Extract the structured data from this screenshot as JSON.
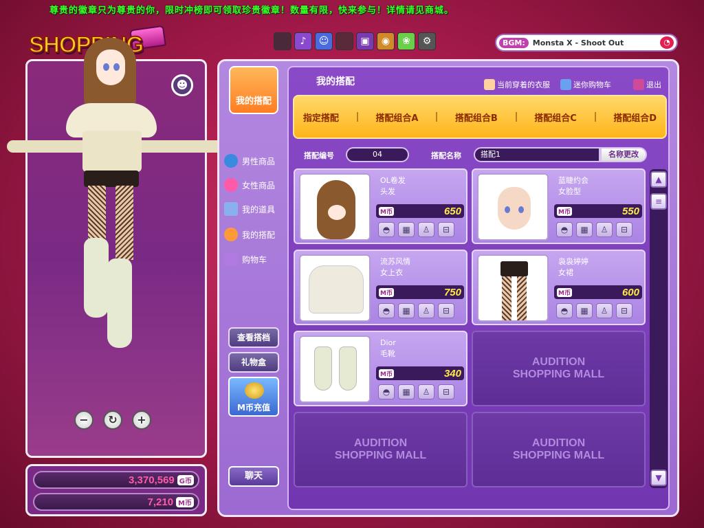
{
  "ticker": "尊贵的徽章只为尊贵的你，限时冲榜即可领取珍贵徽章！数量有限，快来参与！详情请见商城。",
  "logo": "SHOPPING MALL",
  "bgm": {
    "label": "BGM:",
    "song": "Monsta X - Shoot Out"
  },
  "currency": {
    "g_value": "3,370,569",
    "g_unit": "G币",
    "m_value": "7,210",
    "m_unit": "M币"
  },
  "side_tab": "我的搭配",
  "nav": [
    "男性商品",
    "女性商品",
    "我的道具",
    "我的搭配",
    "购物车"
  ],
  "left_buttons": {
    "view": "查看搭档",
    "gift": "礼物盒",
    "recharge": "M币充值",
    "chat": "聊天"
  },
  "content": {
    "title": "我的搭配",
    "header_links": {
      "wearing": "当前穿着的衣服",
      "mini_cart": "迷你购物车",
      "exit": "退出"
    },
    "tabs": [
      "指定搭配",
      "搭配组合A",
      "搭配组合B",
      "搭配组合C",
      "搭配组合D"
    ],
    "set_number_label": "搭配编号",
    "set_number": "04",
    "set_name_label": "搭配名称",
    "set_name": "搭配1",
    "rename": "名称更改",
    "price_unit": "M币",
    "items": [
      {
        "name": "OL卷发",
        "type": "头发",
        "price": "650"
      },
      {
        "name": "蓝睫约会",
        "type": "女脸型",
        "price": "550"
      },
      {
        "name": "流苏风情",
        "type": "女上衣",
        "price": "750"
      },
      {
        "name": "袅袅婷婷",
        "type": "女裙",
        "price": "600"
      },
      {
        "name": "Dior",
        "type": "毛靴",
        "price": "340"
      }
    ],
    "empty_slot": [
      "AUDITION",
      "SHOPPING MALL"
    ]
  }
}
